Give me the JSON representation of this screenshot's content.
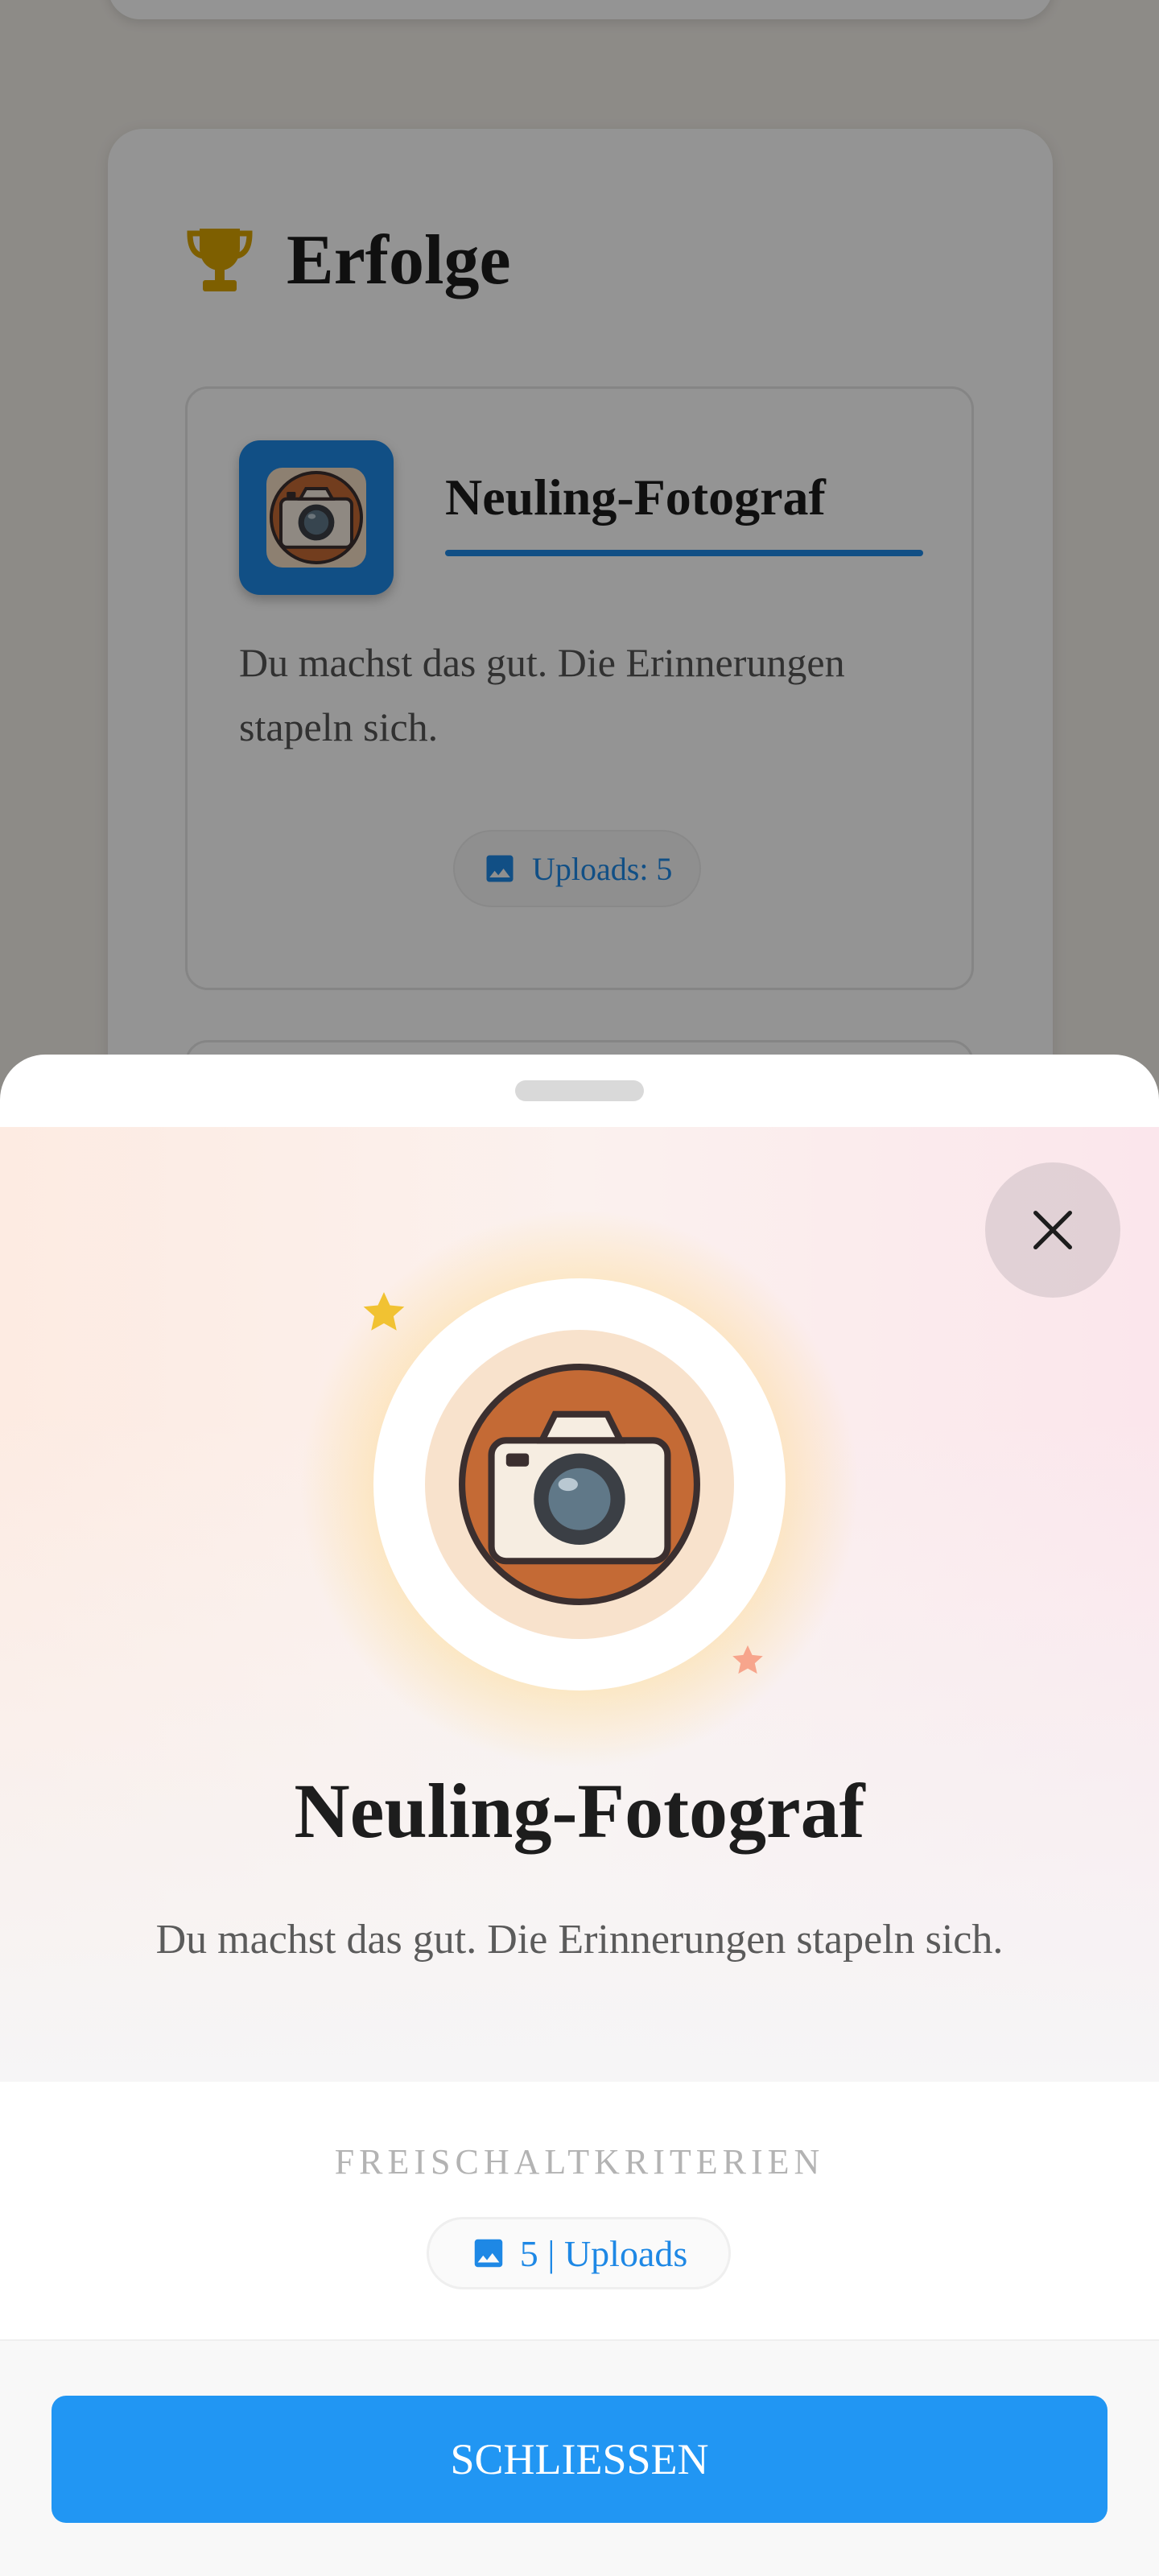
{
  "section": {
    "title": "Erfolge",
    "icon": "trophy-icon"
  },
  "achievement_card": {
    "name": "Neuling-Fotograf",
    "description": "Du machst das gut. Die Erinnerungen stapeln sich.",
    "chip_label": "Uploads: 5",
    "icon": "camera-icon"
  },
  "sheet": {
    "title": "Neuling-Fotograf",
    "description": "Du machst das gut. Die Erinnerungen stapeln sich.",
    "criteria_label": "FREISCHALTKRITERIEN",
    "criteria_chip": "5 | Uploads",
    "close_button_label": "SCHLIESSEN"
  },
  "colors": {
    "accent": "#2196f3",
    "icon_blue": "#1e88e5",
    "badge_brown": "#c46a35",
    "trophy_gold": "#d9a400"
  }
}
